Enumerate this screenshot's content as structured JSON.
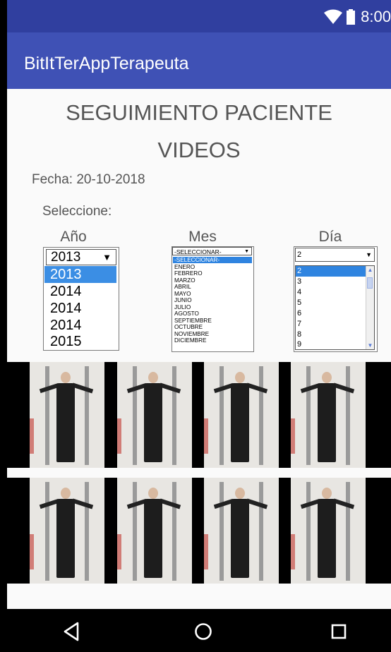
{
  "status_bar": {
    "time": "8:00",
    "icons": [
      "wifi-icon",
      "battery-icon"
    ]
  },
  "app_bar": {
    "title": "BitItTerAppTerapeuta"
  },
  "page": {
    "title_line1": "SEGUIMIENTO PACIENTE",
    "title_line2": "VIDEOS",
    "date_label": "Fecha: 20-10-2018",
    "select_prompt": "Seleccione:"
  },
  "filters": {
    "year": {
      "label": "Año",
      "selected": "2013",
      "options": [
        {
          "text": "2013",
          "selected": true
        },
        {
          "text": "2014",
          "selected": false
        },
        {
          "text": "2014",
          "selected": false
        },
        {
          "text": "2014",
          "selected": false
        },
        {
          "text": "2015",
          "selected": false
        }
      ]
    },
    "month": {
      "label": "Mes",
      "selected": "-SELECCIONAR-",
      "options": [
        {
          "text": "-SELECCIONAR-",
          "selected": true
        },
        {
          "text": "ENERO",
          "selected": false
        },
        {
          "text": "FEBRERO",
          "selected": false
        },
        {
          "text": "MARZO",
          "selected": false
        },
        {
          "text": "ABRIL",
          "selected": false
        },
        {
          "text": "MAYO",
          "selected": false
        },
        {
          "text": "JUNIO",
          "selected": false
        },
        {
          "text": "JULIO",
          "selected": false
        },
        {
          "text": "AGOSTO",
          "selected": false
        },
        {
          "text": "SEPTIEMBRE",
          "selected": false
        },
        {
          "text": "OCTUBRE",
          "selected": false
        },
        {
          "text": "NOVIEMBRE",
          "selected": false
        },
        {
          "text": "DICIEMBRE",
          "selected": false
        }
      ]
    },
    "day": {
      "label": "Día",
      "selected": "2",
      "options": [
        {
          "text": "2",
          "selected": true
        },
        {
          "text": "3",
          "selected": false
        },
        {
          "text": "4",
          "selected": false
        },
        {
          "text": "5",
          "selected": false
        },
        {
          "text": "6",
          "selected": false
        },
        {
          "text": "7",
          "selected": false
        },
        {
          "text": "8",
          "selected": false
        },
        {
          "text": "9",
          "selected": false
        }
      ]
    }
  },
  "videos": {
    "rows": 2,
    "per_row": 4
  },
  "nav_bar": {
    "icons": [
      "back-icon",
      "home-icon",
      "recents-icon"
    ]
  },
  "colors": {
    "status_bar": "#303f9f",
    "app_bar": "#3f51b5",
    "selection": "#3b8ee4"
  }
}
